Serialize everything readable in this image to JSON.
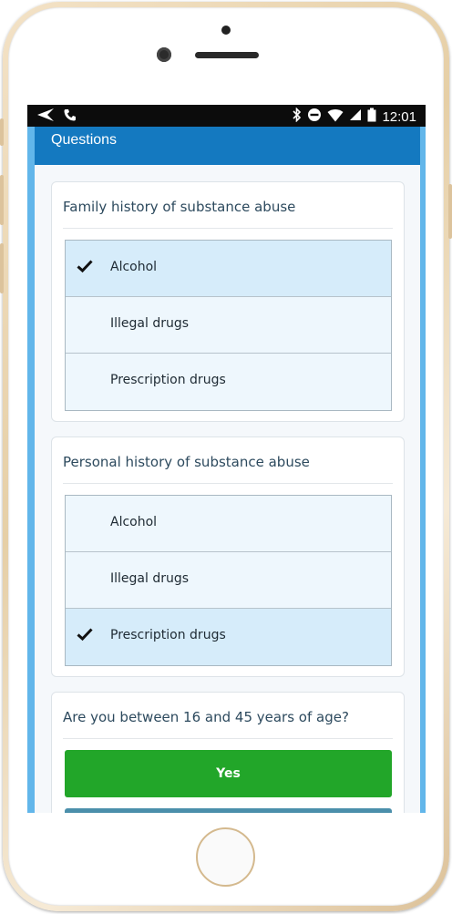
{
  "status_bar": {
    "left_icons": [
      "back-arrow-icon",
      "phone-icon"
    ],
    "right_icons": [
      "bluetooth-icon",
      "do-not-disturb-icon",
      "wifi-icon",
      "signal-icon",
      "battery-icon"
    ],
    "time": "12:01"
  },
  "header": {
    "title": "Questions"
  },
  "colors": {
    "header": "#1479c0",
    "selected_option": "#d6ecfa",
    "option": "#eef7fd",
    "yes_button": "#22a629"
  },
  "questions": [
    {
      "title": "Family history of substance abuse",
      "options": [
        {
          "label": "Alcohol",
          "selected": true
        },
        {
          "label": "Illegal drugs",
          "selected": false
        },
        {
          "label": "Prescription drugs",
          "selected": false
        }
      ]
    },
    {
      "title": "Personal history of substance abuse",
      "options": [
        {
          "label": "Alcohol",
          "selected": false
        },
        {
          "label": "Illegal drugs",
          "selected": false
        },
        {
          "label": "Prescription drugs",
          "selected": true
        }
      ]
    },
    {
      "title": "Are you between 16 and 45 years of age?",
      "buttons": [
        {
          "label": "Yes"
        }
      ]
    }
  ]
}
